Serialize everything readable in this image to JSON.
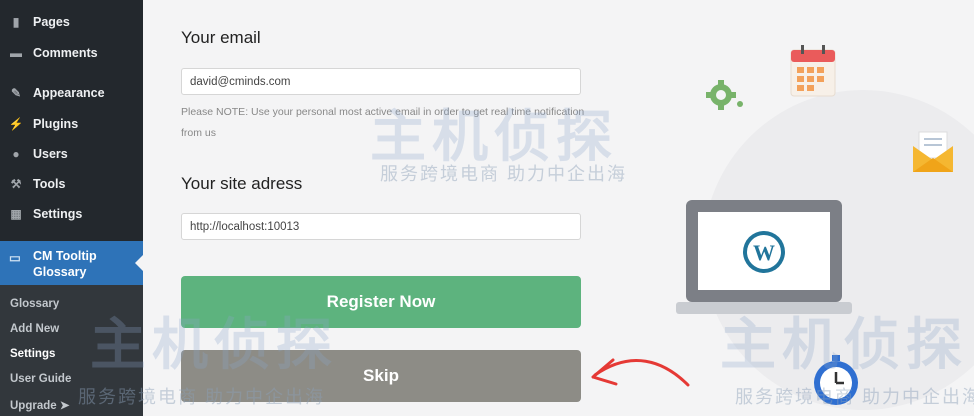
{
  "sidebar": {
    "items": [
      {
        "label": "Pages",
        "icon": "pages-icon"
      },
      {
        "label": "Comments",
        "icon": "comments-icon"
      },
      {
        "label": "Appearance",
        "icon": "appearance-icon"
      },
      {
        "label": "Plugins",
        "icon": "plugins-icon"
      },
      {
        "label": "Users",
        "icon": "users-icon"
      },
      {
        "label": "Tools",
        "icon": "tools-icon"
      },
      {
        "label": "Settings",
        "icon": "settings-icon"
      }
    ],
    "active": {
      "label": "CM Tooltip Glossary",
      "icon": "tooltip-icon"
    },
    "submenu": [
      {
        "label": "Glossary"
      },
      {
        "label": "Add New"
      },
      {
        "label": "Settings"
      },
      {
        "label": "User Guide"
      },
      {
        "label": "Upgrade ➤"
      }
    ],
    "current_submenu": "Settings"
  },
  "form": {
    "email_label": "Your email",
    "email_value": "david@cminds.com",
    "note": "Please NOTE: Use your personal most active email in order to get real time notification from us",
    "site_label": "Your site adress",
    "site_value": "http://localhost:10013",
    "register_button": "Register Now",
    "skip_button": "Skip"
  },
  "watermark": {
    "logo_text": "主机侦探",
    "slogan": "服务跨境电商 助力中企出海"
  },
  "colors": {
    "sidebar_bg": "#23282d",
    "active_bg": "#2e73b8",
    "register": "#5db37e",
    "skip": "#8d8c86",
    "arrow": "#e53935"
  }
}
